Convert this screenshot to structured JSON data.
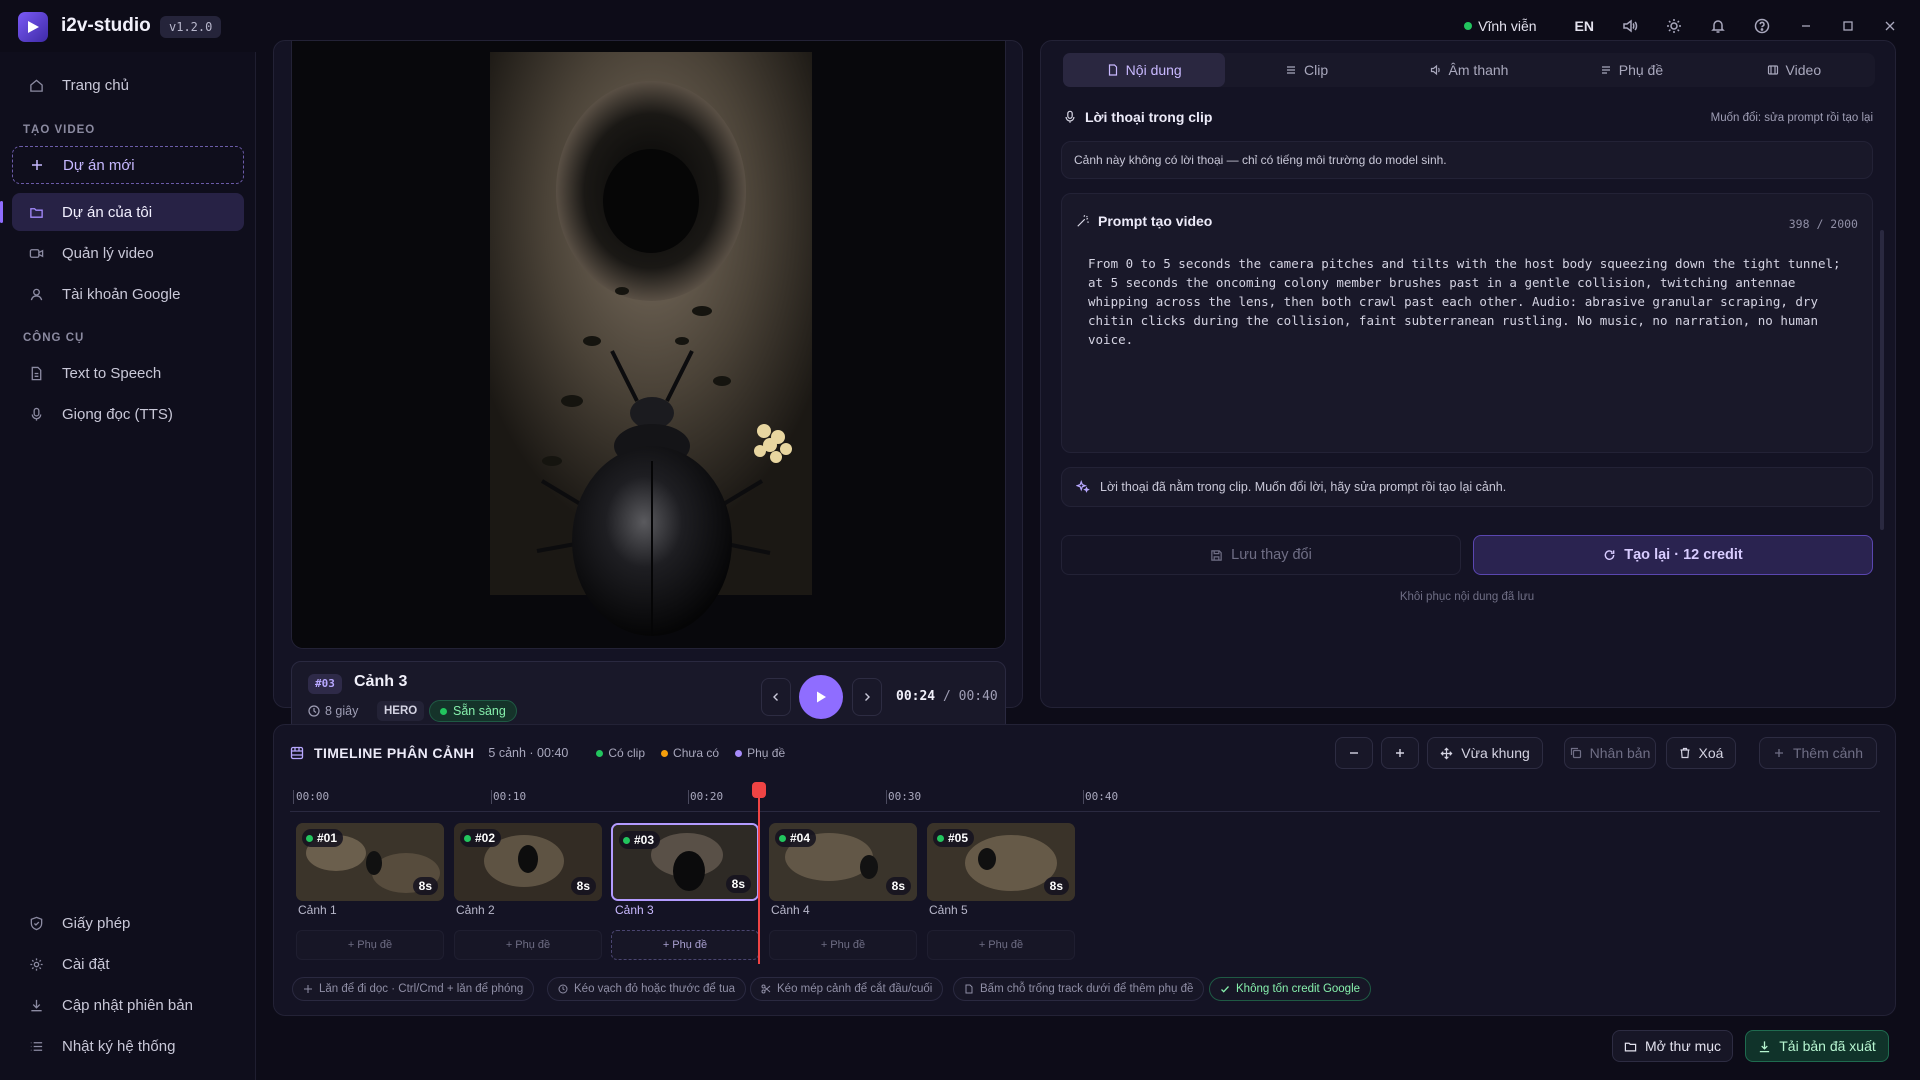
{
  "app": {
    "name": "i2v-studio",
    "version": "v1.2.0"
  },
  "titlebar": {
    "status_label": "Vĩnh viễn",
    "status_color": "#22c55e",
    "lang": "EN"
  },
  "sidebar": {
    "home": "Trang chủ",
    "section_create": "TẠO VIDEO",
    "new_project": "Dự án mới",
    "my_projects": "Dự án của tôi",
    "manage_videos": "Quản lý video",
    "google_account": "Tài khoản Google",
    "section_tools": "CÔNG CỤ",
    "tts": "Text to Speech",
    "voice": "Giọng đọc (TTS)",
    "license": "Giấy phép",
    "settings": "Cài đặt",
    "update": "Cập nhật phiên bản",
    "system_log": "Nhật ký hệ thống"
  },
  "scene": {
    "badge": "#03",
    "title": "Cảnh 3",
    "duration": "8 giây",
    "tag": "HERO",
    "status": "Sẵn sàng",
    "time_current": "00:24",
    "time_sep": "/",
    "time_total": "00:40"
  },
  "tabs": [
    {
      "label": "Nội dung",
      "icon": "document-icon"
    },
    {
      "label": "Clip",
      "icon": "list-icon"
    },
    {
      "label": "Âm thanh",
      "icon": "speaker-icon"
    },
    {
      "label": "Phụ đề",
      "icon": "lines-icon"
    },
    {
      "label": "Video",
      "icon": "film-icon"
    }
  ],
  "dialogue": {
    "title": "Lời thoại trong clip",
    "hint": "Muốn đổi: sửa prompt rồi tạo lại",
    "text": "Cảnh này không có lời thoại — chỉ có tiếng môi trường do model sinh."
  },
  "prompt": {
    "title": "Prompt tạo video",
    "count": "398 / 2000",
    "text": "From 0 to 5 seconds the camera pitches and tilts with the host body squeezing down the tight tunnel; at 5 seconds the oncoming colony member brushes past in a gentle collision, twitching antennae whipping across the lens, then both crawl past each other. Audio: abrasive granular scraping, dry chitin clicks during the collision, faint subterranean rustling. No music, no narration, no human voice."
  },
  "notice": "Lời thoại đã nằm trong clip. Muốn đổi lời, hãy sửa prompt rồi tạo lại cảnh.",
  "actions": {
    "save": "Lưu thay đổi",
    "regen": "Tạo lại · 12 credit",
    "restore": "Khôi phục nội dung đã lưu"
  },
  "timeline": {
    "title": "TIMELINE PHÂN CẢNH",
    "meta": "5 cảnh · 00:40",
    "legend": [
      {
        "label": "Có clip",
        "color": "#22c55e"
      },
      {
        "label": "Chưa có",
        "color": "#f59e0b"
      },
      {
        "label": "Phụ đề",
        "color": "#a78bfa"
      }
    ],
    "buttons": {
      "fit": "Vừa khung",
      "duplicate": "Nhân bản",
      "delete": "Xoá",
      "add": "Thêm cảnh"
    },
    "ticks": [
      "00:00",
      "00:10",
      "00:20",
      "00:30",
      "00:40"
    ],
    "clips": [
      {
        "id": "#01",
        "dur": "8s",
        "name": "Cảnh 1",
        "sub": "+ Phụ đề"
      },
      {
        "id": "#02",
        "dur": "8s",
        "name": "Cảnh 2",
        "sub": "+ Phụ đề"
      },
      {
        "id": "#03",
        "dur": "8s",
        "name": "Cảnh 3",
        "sub": "+ Phụ đề"
      },
      {
        "id": "#04",
        "dur": "8s",
        "name": "Cảnh 4",
        "sub": "+ Phụ đề"
      },
      {
        "id": "#05",
        "dur": "8s",
        "name": "Cảnh 5",
        "sub": "+ Phụ đề"
      }
    ],
    "hints": [
      "Lăn để đi dọc · Ctrl/Cmd + lăn để phóng",
      "Kéo vạch đỏ hoặc thước để tua",
      "Kéo mép cảnh để cắt đầu/cuối",
      "Bấm chỗ trống track dưới để thêm phụ đề",
      "Không tốn credit Google"
    ]
  },
  "footer": {
    "open_folder": "Mở thư mục",
    "download": "Tải bản đã xuất"
  }
}
